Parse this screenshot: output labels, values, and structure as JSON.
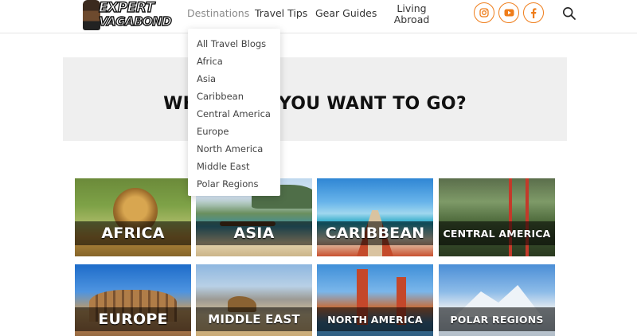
{
  "header": {
    "logo": {
      "line1": "EXPERT",
      "line2": "VAGABOND"
    },
    "nav": {
      "destinations": "Destinations",
      "travel_tips": "Travel Tips",
      "gear_guides": "Gear Guides",
      "living_abroad_line1": "Living",
      "living_abroad_line2": "Abroad"
    },
    "social": [
      "instagram-icon",
      "youtube-icon",
      "facebook-icon"
    ],
    "search_icon": "search-icon",
    "accent_color": "#ef7d1a"
  },
  "dropdown": {
    "items": [
      "All Travel Blogs",
      "Africa",
      "Asia",
      "Caribbean",
      "Central America",
      "Europe",
      "North America",
      "Middle East",
      "Polar Regions"
    ]
  },
  "banner": {
    "title": "WHERE DO YOU WANT TO GO?",
    "background": "#efefef"
  },
  "tiles": [
    {
      "label": "AFRICA"
    },
    {
      "label": "ASIA"
    },
    {
      "label": "CARIBBEAN"
    },
    {
      "label": "CENTRAL AMERICA"
    },
    {
      "label": "EUROPE"
    },
    {
      "label": "MIDDLE EAST"
    },
    {
      "label": "NORTH AMERICA"
    },
    {
      "label": "POLAR REGIONS"
    }
  ]
}
